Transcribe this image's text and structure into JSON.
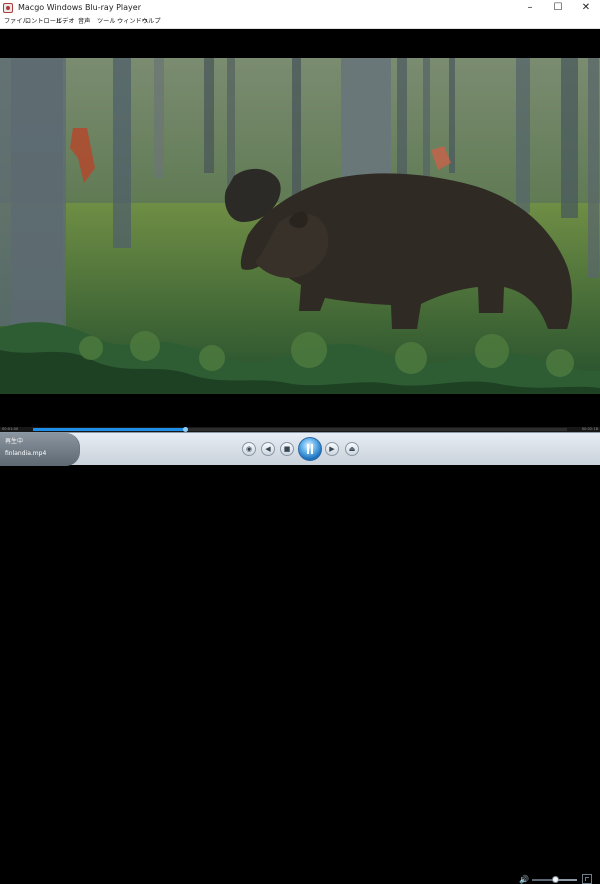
{
  "window": {
    "title": "Macgo Windows Blu-ray Player",
    "controls": [
      "–",
      "☐",
      "✕"
    ]
  },
  "menu": {
    "items": [
      "ファイル",
      "コントロール",
      "ビデオ",
      "音声",
      "ツール",
      "ウィンドウ",
      "ヘルプ"
    ]
  },
  "player": {
    "current_time": "00:01:00",
    "total_time": "00:02:18",
    "progress": 0.28,
    "status": "再生中",
    "filename": "finlandia.mp4",
    "volume": 0.5
  },
  "colors": {
    "accent": "#1f8ee8",
    "control_bar": "#dfe6ee"
  }
}
